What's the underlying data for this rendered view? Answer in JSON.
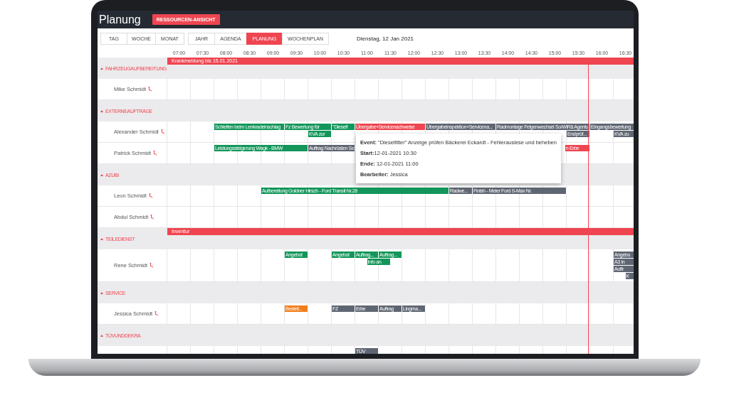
{
  "header": {
    "title": "Planung",
    "button": "RESSOURCEN-ANSICHT"
  },
  "view_groups": [
    {
      "buttons": [
        {
          "label": "TAG",
          "selected": false
        },
        {
          "label": "WOCHE",
          "selected": false
        },
        {
          "label": "MONAT",
          "selected": false
        }
      ]
    },
    {
      "buttons": [
        {
          "label": "JAHR",
          "selected": false
        },
        {
          "label": "AGENDA",
          "selected": false
        },
        {
          "label": "PLANUNG",
          "selected": true
        },
        {
          "label": "WOCHENPLAN",
          "selected": false
        }
      ]
    }
  ],
  "date": "Dienstag, 12 Jan 2021",
  "times": [
    "07:00",
    "07:30",
    "08:00",
    "08:30",
    "09:00",
    "09:30",
    "10:00",
    "10:30",
    "11:00",
    "11:30",
    "12:00",
    "12:30",
    "13:00",
    "13:30",
    "14:00",
    "14:30",
    "15:00",
    "15:30",
    "16:00",
    "16:30"
  ],
  "groups": [
    {
      "name": "FAHRZEUGAUFBEREITUNG",
      "banners": [
        {
          "label": "Krankmeldung bis 15.01.2021",
          "color": "#ef4550"
        }
      ],
      "people": [
        {
          "name": "Mike Schmidt"
        }
      ]
    },
    {
      "name": "EXTERNEAUFTRÄGE",
      "people": [
        {
          "name": "Alexander Schmidt",
          "events": [
            {
              "label": "Schleifen beim Lenkradeinschlag",
              "color": "#12965a"
            },
            {
              "label": "Fz Bewertung für",
              "color": "#12965a"
            },
            {
              "label": "KVA zur",
              "color": "#12965a"
            },
            {
              "label": "\"Dieself",
              "color": "#12965a"
            },
            {
              "label": "Übergabe+Servicenachweise",
              "color": "#ef4550"
            },
            {
              "label": "Übergabeinspektion+Servicena...",
              "color": "#5f6673"
            },
            {
              "label": "Radmontage Felgenwechsel So/WiRä Agentu",
              "color": "#5f6673"
            },
            {
              "label": "Endprüf...",
              "color": "#5f6673"
            },
            {
              "label": "Eingangsbewertung",
              "color": "#5f6673"
            },
            {
              "label": "KVA zu",
              "color": "#5f6673"
            }
          ]
        },
        {
          "name": "Patrick Schmidt",
          "events": [
            {
              "label": "Leistungssteigerung Wagk - BMW",
              "color": "#12965a"
            },
            {
              "label": "Auftrag Nachrüsten Se",
              "color": "#5f6673"
            },
            {
              "label": "n Erbe",
              "color": "#ef4550"
            }
          ]
        }
      ]
    },
    {
      "name": "AZUBI",
      "people": [
        {
          "name": "Leon Schmidt",
          "events": [
            {
              "label": "Aufbereitung Goldner Hirsch - Ford Transit Nr.28",
              "color": "#12965a"
            },
            {
              "label": "Radwe...",
              "color": "#5f6673"
            },
            {
              "label": "Finish - Meier Ford S-Max Nr.",
              "color": "#5f6673"
            }
          ]
        },
        {
          "name": "Abdul Schmidt"
        }
      ]
    },
    {
      "name": "TEILEDIENST",
      "banners": [
        {
          "label": "Inventur",
          "color": "#ef4550"
        }
      ],
      "people": [
        {
          "name": "Rene Schmidt",
          "events": [
            {
              "label": "Angebot",
              "color": "#12965a"
            },
            {
              "label": "Angebot",
              "color": "#12965a"
            },
            {
              "label": "Auftrag...",
              "color": "#12965a"
            },
            {
              "label": "Auftrag...",
              "color": "#12965a"
            },
            {
              "label": "Info an",
              "color": "#12965a"
            },
            {
              "label": "Angebo",
              "color": "#5f6673"
            },
            {
              "label": "A3 in",
              "color": "#5f6673"
            },
            {
              "label": "Auftr",
              "color": "#5f6673"
            },
            {
              "label": "K",
              "color": "#5f6673"
            }
          ]
        }
      ]
    },
    {
      "name": "SERVICE",
      "people": [
        {
          "name": "Jessica Schmidt",
          "events": [
            {
              "label": "Bestell...",
              "color": "#f07d1a"
            },
            {
              "label": "FZ",
              "color": "#5f6673"
            },
            {
              "label": "Erbe",
              "color": "#5f6673"
            },
            {
              "label": "Auftrag",
              "color": "#5f6673"
            },
            {
              "label": "Lingma...",
              "color": "#5f6673"
            }
          ]
        }
      ]
    },
    {
      "name": "TÜVUNDDEKRA",
      "people": [
        {
          "events": [
            {
              "label": "TÜV",
              "color": "#5f6673"
            }
          ]
        }
      ]
    }
  ],
  "tooltip": {
    "lines": [
      "**Event:** \"Dieselfilter\" Anzeige prüfen Bäckerei Eckardt - Fehlerauslese und beheben",
      "**Start:**12-01-2021 10:30",
      "**Ende:** 12-01-2021 11:00",
      "**Bearbeiter:** Jessica"
    ]
  }
}
